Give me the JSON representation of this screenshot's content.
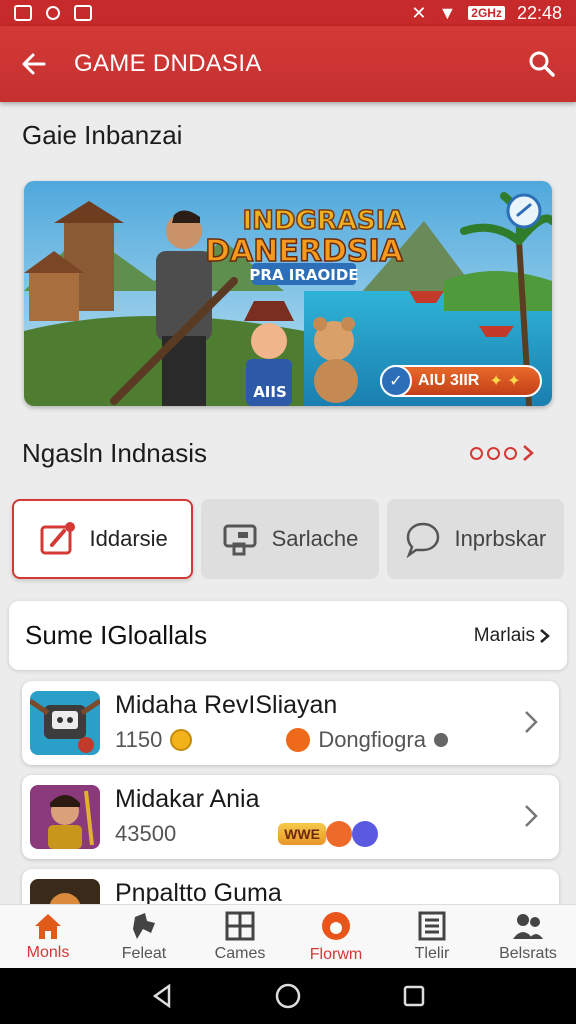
{
  "status_bar": {
    "time": "22:48",
    "network": "2GHz"
  },
  "app_bar": {
    "title": "GAME DNDASIA"
  },
  "featured": {
    "section_title": "Gaie Inbanzai",
    "banner_title_1": "INDGRASIA",
    "banner_title_2": "DANERDSIA",
    "banner_subtitle": "PRA IRAOIDE",
    "banner_cta": "AIU 3IIR",
    "banner_badge": "AIIS"
  },
  "section2": {
    "title": "Ngasln Indnasis"
  },
  "categories": [
    {
      "label": "Iddarsie",
      "icon": "calendar-edit-icon",
      "active": true
    },
    {
      "label": "Sarlache",
      "icon": "card-icon",
      "active": false
    },
    {
      "label": "Inprbskar",
      "icon": "chat-icon",
      "active": false
    }
  ],
  "list_header": {
    "title": "Sume IGloallals",
    "more": "Marlais"
  },
  "games": [
    {
      "name": "Midaha RevISliayan",
      "count": "1150",
      "tag": "Dongfiogra"
    },
    {
      "name": "Midakar Ania",
      "count": "43500",
      "badge": "WWE"
    },
    {
      "name": "Pnpaltto Guma"
    }
  ],
  "bottom_nav": [
    {
      "label": "Monls",
      "icon": "home-icon",
      "active": true
    },
    {
      "label": "Feleat",
      "icon": "puzzle-icon",
      "active": false
    },
    {
      "label": "Cames",
      "icon": "grid-icon",
      "active": false
    },
    {
      "label": "Florwm",
      "icon": "flame-icon",
      "active": false
    },
    {
      "label": "Tlelir",
      "icon": "list-icon",
      "active": false
    },
    {
      "label": "Belsrats",
      "icon": "people-icon",
      "active": false
    }
  ],
  "colors": {
    "accent": "#d33a36",
    "app_bar": "#c62a2a"
  }
}
